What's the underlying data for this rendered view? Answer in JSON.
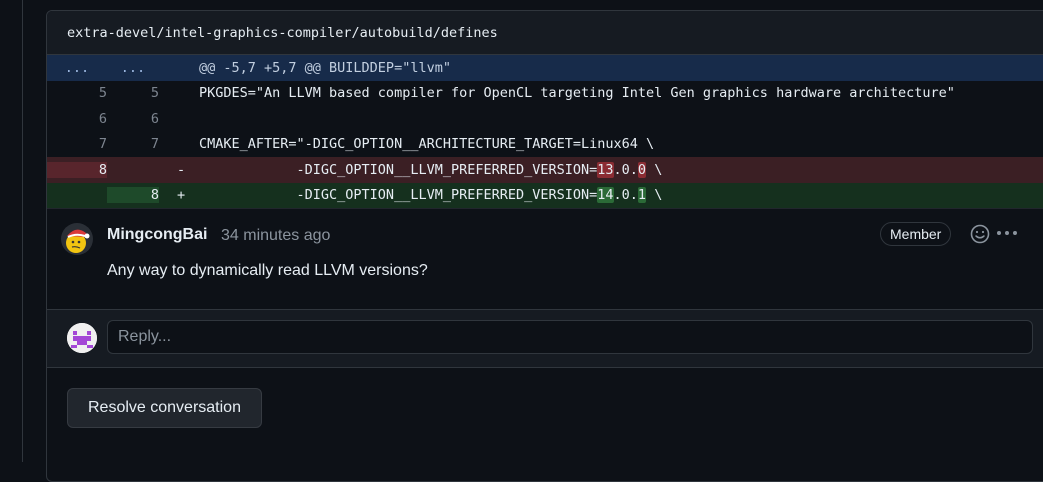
{
  "file": {
    "path": "extra-devel/intel-graphics-compiler/autobuild/defines"
  },
  "diff": {
    "hunk": {
      "left": "...",
      "right": "...",
      "text": "@@ -5,7 +5,7 @@ BUILDDEP=\"llvm\""
    },
    "lines": [
      {
        "left": "5",
        "right": "5",
        "marker": "",
        "code": "PKGDES=\"An LLVM based compiler for OpenCL targeting Intel Gen graphics hardware architecture\""
      },
      {
        "left": "6",
        "right": "6",
        "marker": "",
        "code": ""
      },
      {
        "left": "7",
        "right": "7",
        "marker": "",
        "code": "CMAKE_AFTER=\"-DIGC_OPTION__ARCHITECTURE_TARGET=Linux64 \\"
      }
    ],
    "deleted": {
      "left": "8",
      "right": "",
      "marker": "-",
      "prefix": "            -DIGC_OPTION__LLVM_PREFERRED_VERSION=",
      "hl1": "13",
      "mid": ".0.",
      "hl2": "0",
      "suffix": " \\"
    },
    "added": {
      "left": "",
      "right": "8",
      "marker": "+",
      "prefix": "            -DIGC_OPTION__LLVM_PREFERRED_VERSION=",
      "hl1": "14",
      "mid": ".0.",
      "hl2": "1",
      "suffix": " \\"
    }
  },
  "comment": {
    "author": "MingcongBai",
    "time": "34 minutes ago",
    "badge": "Member",
    "body": "Any way to dynamically read LLVM versions?",
    "icons": {
      "reaction": "smiley-icon",
      "more": "kebab-horizontal-icon"
    }
  },
  "reply": {
    "placeholder": "Reply..."
  },
  "actions": {
    "resolve_label": "Resolve conversation"
  },
  "colors": {
    "background": "#0d1117",
    "hunk_bg": "#172b4a",
    "deleted_bg": "#3b1f24",
    "added_bg": "#15301e"
  }
}
